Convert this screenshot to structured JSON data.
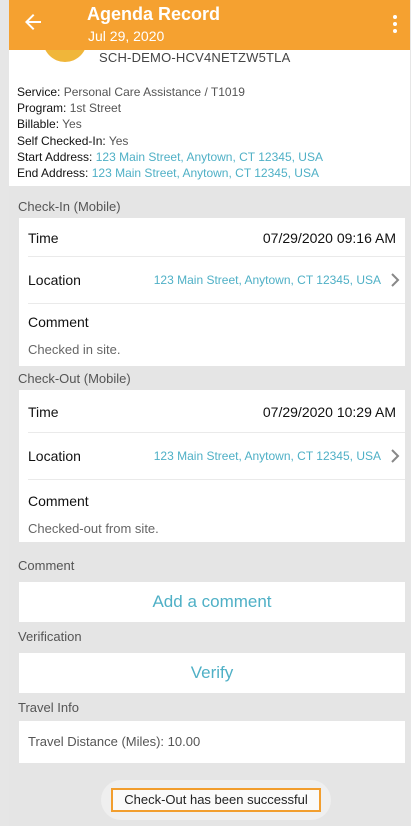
{
  "header": {
    "title": "Agenda Record",
    "date": "Jul 29, 2020",
    "back_icon": "arrow-left-icon",
    "menu_icon": "more-vert-icon"
  },
  "record": {
    "code": "SCH-DEMO-HCV4NETZW5TLA",
    "service_label": "Service:",
    "service_value": "Personal Care Assistance / T1019",
    "program_label": "Program:",
    "program_value": "1st Street",
    "billable_label": "Billable:",
    "billable_value": "Yes",
    "self_checkin_label": "Self Checked-In:",
    "self_checkin_value": "Yes",
    "start_address_label": "Start Address:",
    "start_address_value": "123 Main Street, Anytown, CT 12345, USA",
    "end_address_label": "End Address:",
    "end_address_value": "123 Main Street, Anytown, CT 12345, USA"
  },
  "checkin": {
    "section_label": "Check-In (Mobile)",
    "time_label": "Time",
    "time_value": "07/29/2020 09:16 AM",
    "location_label": "Location",
    "location_value": "123 Main Street, Anytown, CT 12345, USA",
    "comment_label": "Comment",
    "comment_value": "Checked in site."
  },
  "checkout": {
    "section_label": "Check-Out (Mobile)",
    "time_label": "Time",
    "time_value": "07/29/2020 10:29 AM",
    "location_label": "Location",
    "location_value": "123 Main Street, Anytown, CT 12345, USA",
    "comment_label": "Comment",
    "comment_value": "Checked-out from site."
  },
  "comment_section": {
    "section_label": "Comment",
    "button_label": "Add a comment"
  },
  "verification": {
    "section_label": "Verification",
    "button_label": "Verify"
  },
  "travel": {
    "section_label": "Travel Info",
    "distance_text": "Travel Distance (Miles): 10.00"
  },
  "toast": {
    "message": "Check-Out has been successful"
  },
  "colors": {
    "accent": "#f5a130",
    "link": "#4fb0c6",
    "toast_border": "#f29e2e"
  }
}
